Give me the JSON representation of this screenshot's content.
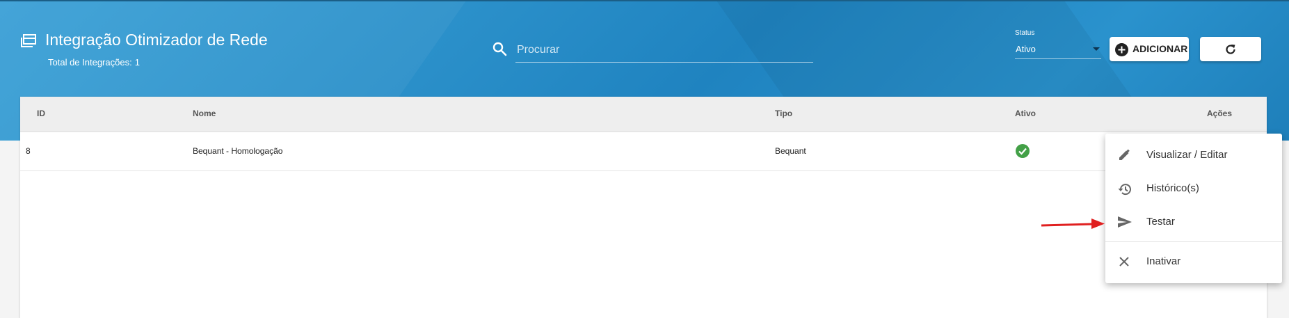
{
  "header": {
    "title": "Integração Otimizador de Rede",
    "subtitle_label": "Total de Integrações:",
    "subtitle_count": "1"
  },
  "search": {
    "placeholder": "Procurar",
    "value": ""
  },
  "status": {
    "label": "Status",
    "value": "Ativo"
  },
  "toolbar": {
    "add_label": "ADICIONAR"
  },
  "table": {
    "columns": [
      "ID",
      "Nome",
      "Tipo",
      "Ativo",
      "Ações"
    ],
    "rows": [
      {
        "id": "8",
        "nome": "Bequant - Homologação",
        "tipo": "Bequant",
        "ativo": true
      }
    ]
  },
  "menu": {
    "items": [
      {
        "label": "Visualizar / Editar",
        "icon": "pencil-icon"
      },
      {
        "label": "Histórico(s)",
        "icon": "history-icon"
      },
      {
        "label": "Testar",
        "icon": "send-icon"
      },
      {
        "label": "Inativar",
        "icon": "close-icon"
      }
    ]
  },
  "colors": {
    "header_bg": "#2a8fc9",
    "active_green": "#43a047",
    "annotation_arrow": "#e02020"
  }
}
